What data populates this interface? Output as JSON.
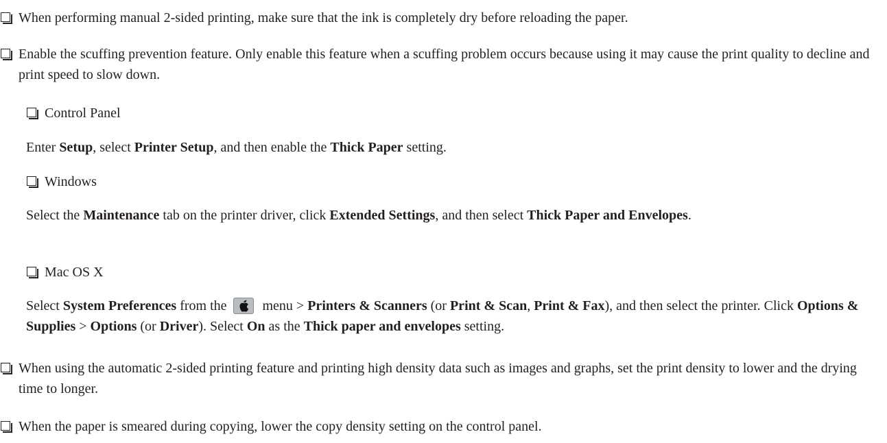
{
  "bullets": {
    "b1": "When performing manual 2-sided printing, make sure that the ink is completely dry before reloading the paper.",
    "b2": "Enable the scuffing prevention feature. Only enable this feature when a scuffing problem occurs because using it may cause the print quality to decline and print speed to slow down.",
    "b3": "When using the automatic 2-sided printing feature and printing high density data such as images and graphs, set the print density to lower and the drying time to longer.",
    "b4": "When the paper is smeared during copying, lower the copy density setting on the control panel."
  },
  "control_panel": {
    "heading": "Control Panel",
    "t1": "Enter ",
    "setup": "Setup",
    "t2": ", select ",
    "printer_setup": "Printer Setup",
    "t3": ", and then enable the ",
    "thick_paper": "Thick Paper",
    "t4": " setting."
  },
  "windows": {
    "heading": "Windows",
    "t1": "Select the ",
    "maintenance": "Maintenance",
    "t2": " tab on the printer driver, click ",
    "extended_settings": "Extended Settings",
    "t3": ", and then select ",
    "thick_paper_envelopes": "Thick Paper and Envelopes",
    "t4": "."
  },
  "mac": {
    "heading": "Mac OS X",
    "t1": "Select ",
    "system_preferences": "System Preferences",
    "t2": " from the ",
    "apple_icon": "apple-menu-icon",
    "t3": " menu > ",
    "printers_scanners": "Printers & Scanners",
    "t4": " (or ",
    "print_scan": "Print & Scan",
    "t5": ", ",
    "print_fax": "Print & Fax",
    "t6": "), and then select the printer. Click ",
    "options_supplies": "Options & Supplies",
    "t7": " > ",
    "options": "Options",
    "t8": " (or ",
    "driver": "Driver",
    "t9": "). Select ",
    "on": "On",
    "t10": " as the ",
    "thick_paper_envelopes": "Thick paper and envelopes",
    "t11": " setting."
  }
}
